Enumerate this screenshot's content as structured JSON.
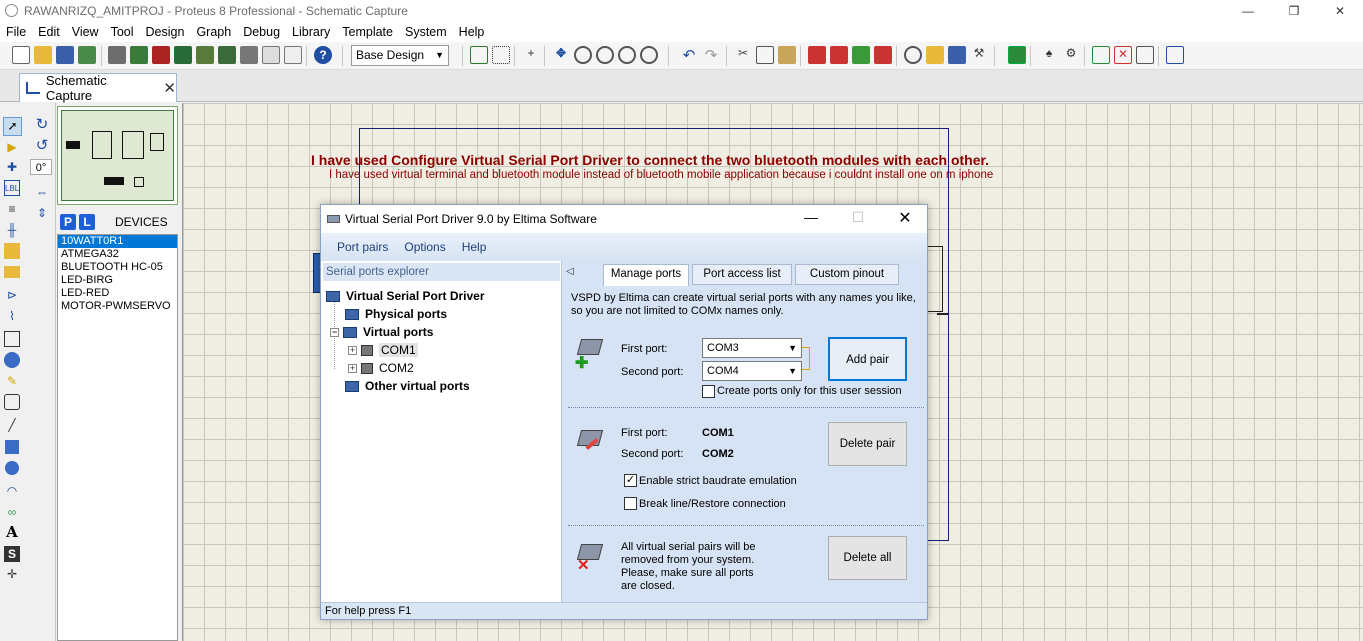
{
  "app": {
    "title": "RAWANRIZQ_AMITPROJ - Proteus 8 Professional - Schematic Capture",
    "window_controls": {
      "minimize": "—",
      "restore": "❐",
      "close": "✕"
    }
  },
  "menu": [
    "File",
    "Edit",
    "View",
    "Tool",
    "Design",
    "Graph",
    "Debug",
    "Library",
    "Template",
    "System",
    "Help"
  ],
  "toolbar": {
    "design_select": "Base Design"
  },
  "doc_tab": {
    "label": "Schematic Capture",
    "close": "✕"
  },
  "left_panel": {
    "rotation": "0°",
    "devices_label": "DEVICES",
    "p_button": "P",
    "l_button": "L"
  },
  "devices": [
    "10WATT0R1",
    "ATMEGA32",
    "BLUETOOTH HC-05",
    "LED-BIRG",
    "LED-RED",
    "MOTOR-PWMSERVO"
  ],
  "devices_selected_index": 0,
  "canvas": {
    "headline": "I have used Configure Virtual Serial Port Driver to connect the two bluetooth modules with each other.",
    "subline": "I have used virtual terminal and bluetooth module instead of bluetooth mobile application because i couldnt install one on m iphone"
  },
  "dialog": {
    "title": "Virtual Serial Port Driver 9.0 by Eltima Software",
    "menu": [
      "Port pairs",
      "Options",
      "Help"
    ],
    "explorer_header": "Serial ports explorer",
    "tree": {
      "root": "Virtual Serial Port Driver",
      "physical": "Physical ports",
      "virtual": "Virtual ports",
      "com1": "COM1",
      "com2": "COM2",
      "other": "Other virtual ports"
    },
    "tabs": [
      "Manage ports",
      "Port access list",
      "Custom pinout"
    ],
    "intro": "VSPD by Eltima can create virtual serial ports with any names you like, so you are not limited to COMx names only.",
    "add": {
      "first_label": "First port:",
      "second_label": "Second port:",
      "first_value": "COM3",
      "second_value": "COM4",
      "session_checkbox": "Create ports only for this user session",
      "button": "Add pair"
    },
    "delete": {
      "first_label": "First port:",
      "second_label": "Second port:",
      "first_value": "COM1",
      "second_value": "COM2",
      "strict_checkbox": "Enable strict baudrate emulation",
      "break_checkbox": "Break line/Restore connection",
      "button": "Delete pair"
    },
    "delete_all": {
      "text": "All virtual serial pairs will be removed from your system. Please, make sure all ports are closed.",
      "button": "Delete all"
    },
    "status": "For help press F1"
  }
}
